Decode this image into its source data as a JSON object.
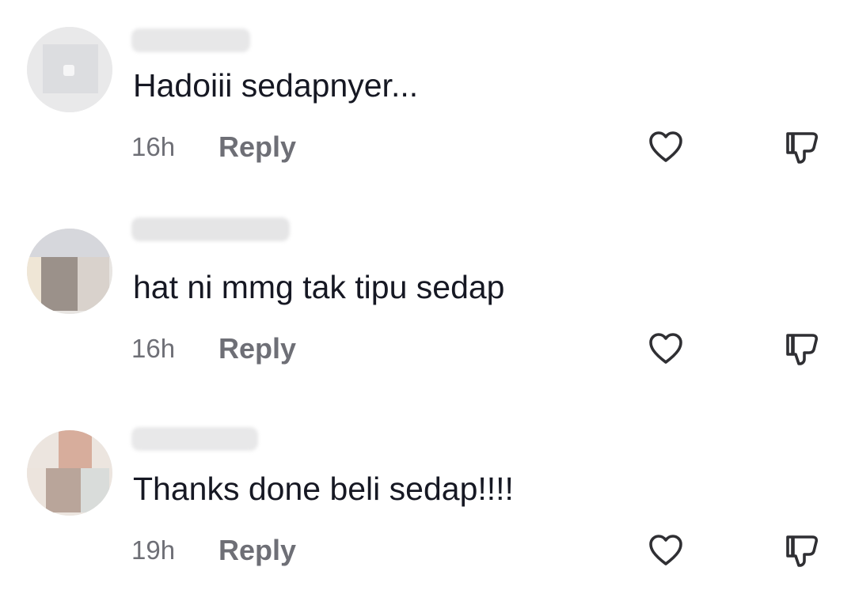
{
  "comments": [
    {
      "text": "Hadoiii sedapnyer...",
      "time": "16h",
      "reply_label": "Reply",
      "like_icon": "heart-outline-icon",
      "dislike_icon": "thumbs-down-icon"
    },
    {
      "text": "hat ni mmg tak tipu sedap",
      "time": "16h",
      "reply_label": "Reply",
      "like_icon": "heart-outline-icon",
      "dislike_icon": "thumbs-down-icon"
    },
    {
      "text": "Thanks done beli sedap!!!!",
      "time": "19h",
      "reply_label": "Reply",
      "like_icon": "heart-outline-icon",
      "dislike_icon": "thumbs-down-icon"
    }
  ],
  "colors": {
    "text": "#161823",
    "secondary": "#6e6f76",
    "icon": "#2f2f33",
    "background": "#ffffff"
  }
}
